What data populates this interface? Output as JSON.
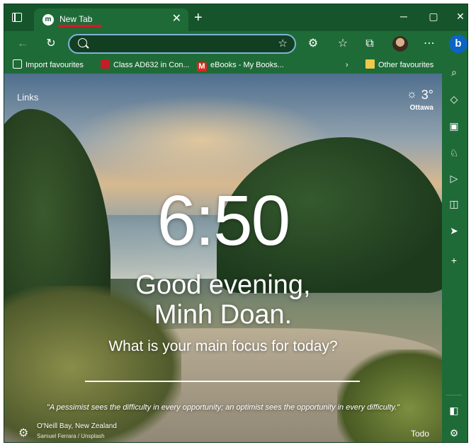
{
  "browser": {
    "tab": {
      "title": "New Tab",
      "favicon": "m"
    },
    "window_controls": {
      "minimize": "─",
      "maximize": "▢",
      "close": "✕"
    },
    "bookmarks": [
      {
        "label": "Import favourites",
        "icon": "import-icon"
      },
      {
        "label": "Class AD632 in Con...",
        "icon": "red-square-icon"
      },
      {
        "label": "eBooks - My Books...",
        "icon": "m-logo-icon"
      },
      {
        "label": "Other favourites",
        "icon": "folder-icon"
      }
    ],
    "bing_label": "b"
  },
  "newtab": {
    "links_label": "Links",
    "weather": {
      "temp": "3°",
      "city": "Ottawa"
    },
    "clock": "6:50",
    "greeting_line1": "Good evening,",
    "greeting_line2": "Minh Doan.",
    "focus_question": "What is your main focus for today?",
    "quote": "\"A pessimist sees the difficulty in every opportunity; an optimist sees the opportunity in every difficulty.\"",
    "photo_location": "O'Neill Bay, New Zealand",
    "photo_credit": "Samuel Ferrara / Unsplash",
    "todo_label": "Todo"
  },
  "colors": {
    "accent": "#1f6b38",
    "tabstrip": "#16552b",
    "address_border": "#7fb3d9",
    "bing": "#0b63c5"
  }
}
